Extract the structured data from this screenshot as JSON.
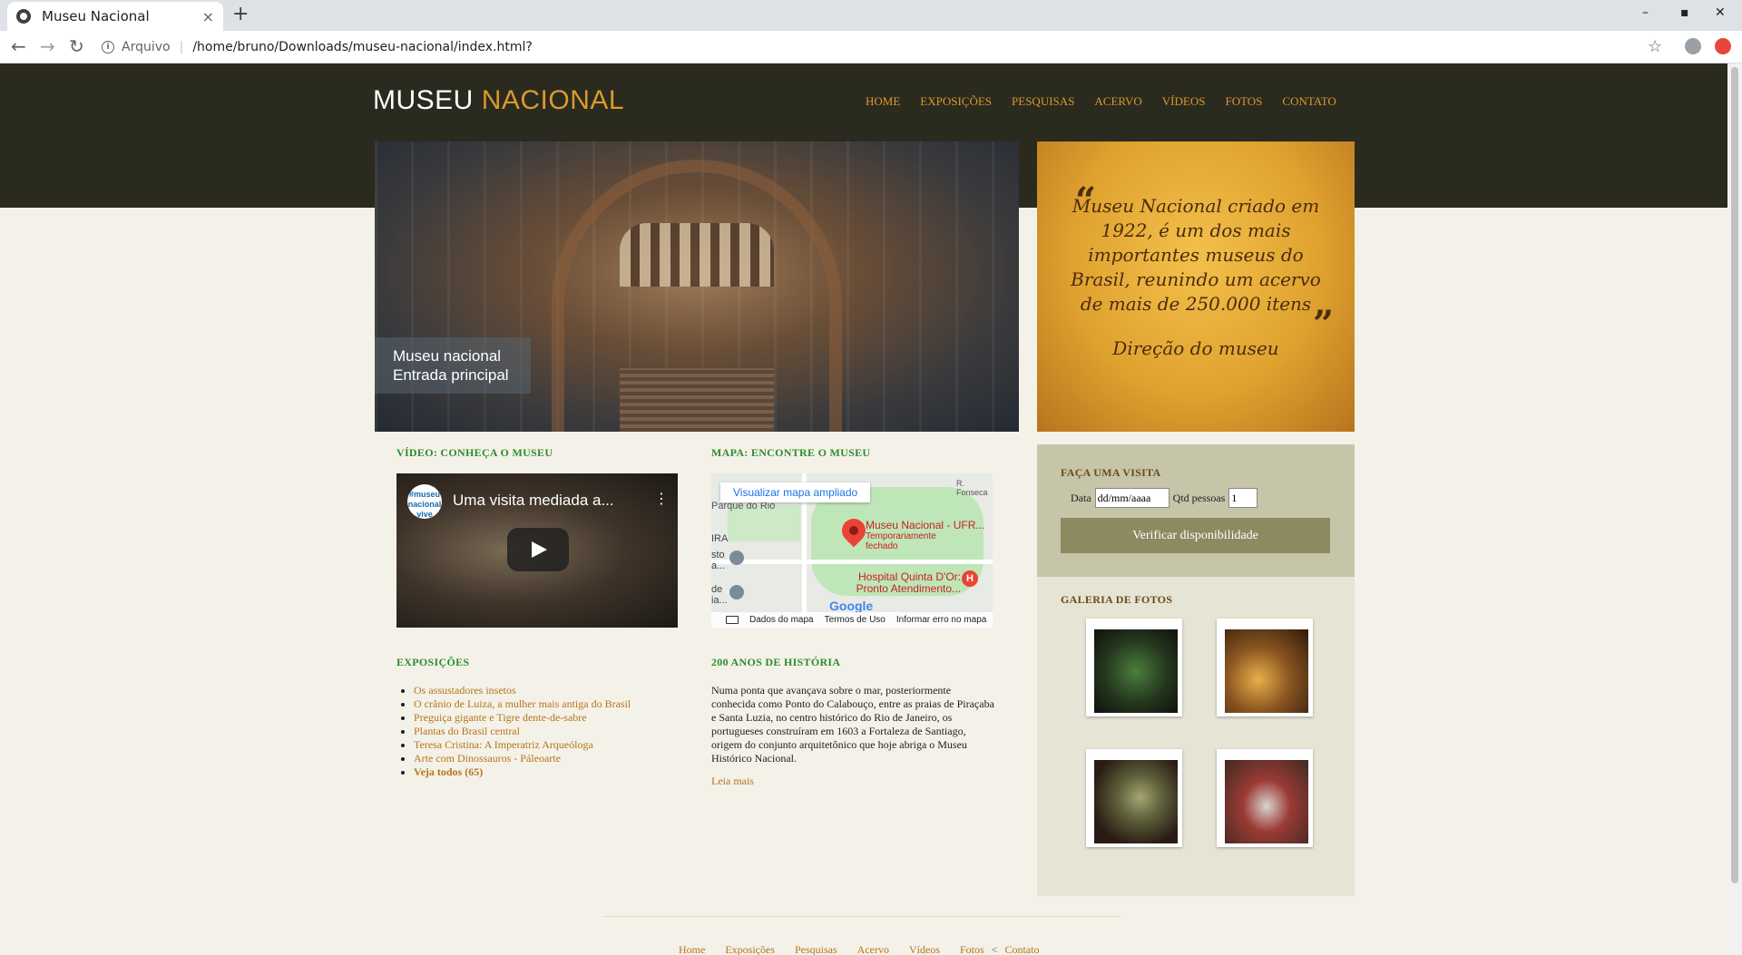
{
  "browser": {
    "tab_title": "Museu Nacional",
    "tab_close": "×",
    "new_tab": "+",
    "win_min": "–",
    "win_max": "▪",
    "win_close": "✕",
    "back": "←",
    "forward": "→",
    "reload": "↻",
    "scheme_label": "Arquivo",
    "url": "/home/bruno/Downloads/museu-nacional/index.html?",
    "bookmark": "☆"
  },
  "site": {
    "logo_part1": "MUSEU",
    "logo_part2": "NACIONAL",
    "nav": [
      "HOME",
      "EXPOSIÇÕES",
      "PESQUISAS",
      "ACERVO",
      "VÍDEOS",
      "FOTOS",
      "CONTATO"
    ]
  },
  "hero": {
    "caption_line1": "Museu nacional",
    "caption_line2": "Entrada principal"
  },
  "quote": {
    "open": "“",
    "close": "”",
    "text": "Museu Nacional criado em 1922, é um dos mais importantes museus do Brasil, reunindo um acervo de mais de 250.000 itens",
    "author": "Direção do museu"
  },
  "video_section": {
    "title": "VÍDEO: CONHEÇA O MUSEU",
    "channel_badge": "#museu nacional vive",
    "video_title": "Uma visita mediada a...",
    "menu": "⋮"
  },
  "map_section": {
    "title": "MAPA: ENCONTRE O MUSEU",
    "view_larger": "Visualizar mapa ampliado",
    "place_name": "Museu Nacional - UFR...",
    "place_status": "Temporariamente fechado",
    "hospital": "Hospital Quinta D'Or: Pronto Atendimento...",
    "hospital_icon": "H",
    "street": "R. Fonseca",
    "park_label": "Parque do Rio",
    "side_text_1": "IRA",
    "side_text_2": "sto a...",
    "side_text_3": "de ia...",
    "google": "Google",
    "map_data": "Dados do mapa",
    "terms": "Termos de Uso",
    "report": "Informar erro no mapa"
  },
  "exhibitions": {
    "title": "EXPOSIÇÕES",
    "items": [
      "Os assustadores insetos",
      "O crânio de Luiza, a mulher mais antiga do Brasil",
      "Preguiça gigante e Tigre dente-de-sabre",
      "Plantas do Brasil central",
      "Teresa Cristina: A Imperatriz Arqueóloga",
      "Arte com Dinossauros - Páleoarte"
    ],
    "see_all": "Veja todos (65)"
  },
  "history": {
    "title": "200 ANOS DE HISTÓRIA",
    "text": "Numa ponta que avançava sobre o mar, posteriormente conhecida como Ponto do Calabouço, entre as praias de Piraçaba e Santa Luzia, no centro histórico do Rio de Janeiro, os portugueses construíram em 1603 a Fortaleza de Santiago, origem do conjunto arquitetônico que hoje abriga o Museu Histórico Nacional.",
    "read_more": "Leia mais"
  },
  "visit": {
    "title": "FAÇA UMA VISITA",
    "date_label": "Data",
    "date_value": "dd/mm/aaaa",
    "qty_label": "Qtd pessoas",
    "qty_value": "1",
    "button": "Verificar disponibilidade"
  },
  "gallery": {
    "title": "GALERIA DE FOTOS"
  },
  "footer": {
    "links": [
      "Home",
      "Exposições",
      "Pesquisas",
      "Acervo",
      "Vídeos",
      "Fotos"
    ],
    "separator": "<",
    "last": "Contato"
  }
}
